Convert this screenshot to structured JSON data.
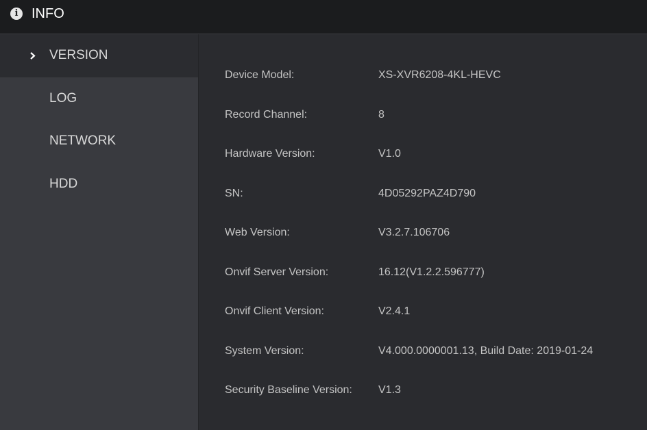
{
  "header": {
    "title": "INFO",
    "icon": "info-icon"
  },
  "sidebar": {
    "items": [
      {
        "label": "VERSION",
        "active": true
      },
      {
        "label": "LOG",
        "active": false
      },
      {
        "label": "NETWORK",
        "active": false
      },
      {
        "label": "HDD",
        "active": false
      }
    ]
  },
  "version": {
    "rows": [
      {
        "key": "Device Model:",
        "value": "XS-XVR6208-4KL-HEVC"
      },
      {
        "key": "Record Channel:",
        "value": "8"
      },
      {
        "key": "Hardware Version:",
        "value": "V1.0"
      },
      {
        "key": "SN:",
        "value": "4D05292PAZ4D790"
      },
      {
        "key": "Web Version:",
        "value": "V3.2.7.106706"
      },
      {
        "key": "Onvif Server Version:",
        "value": "16.12(V1.2.2.596777)"
      },
      {
        "key": "Onvif Client Version:",
        "value": "V2.4.1"
      },
      {
        "key": "System Version:",
        "value": "V4.000.0000001.13, Build Date: 2019-01-24"
      },
      {
        "key": "Security Baseline Version:",
        "value": "V1.3"
      }
    ]
  },
  "colors": {
    "topbar": "#1b1c1e",
    "sidebar": "#393a3f",
    "sidebar_active": "#2b2c30",
    "main": "#2a2b2f",
    "text": "#c4c4c4"
  }
}
